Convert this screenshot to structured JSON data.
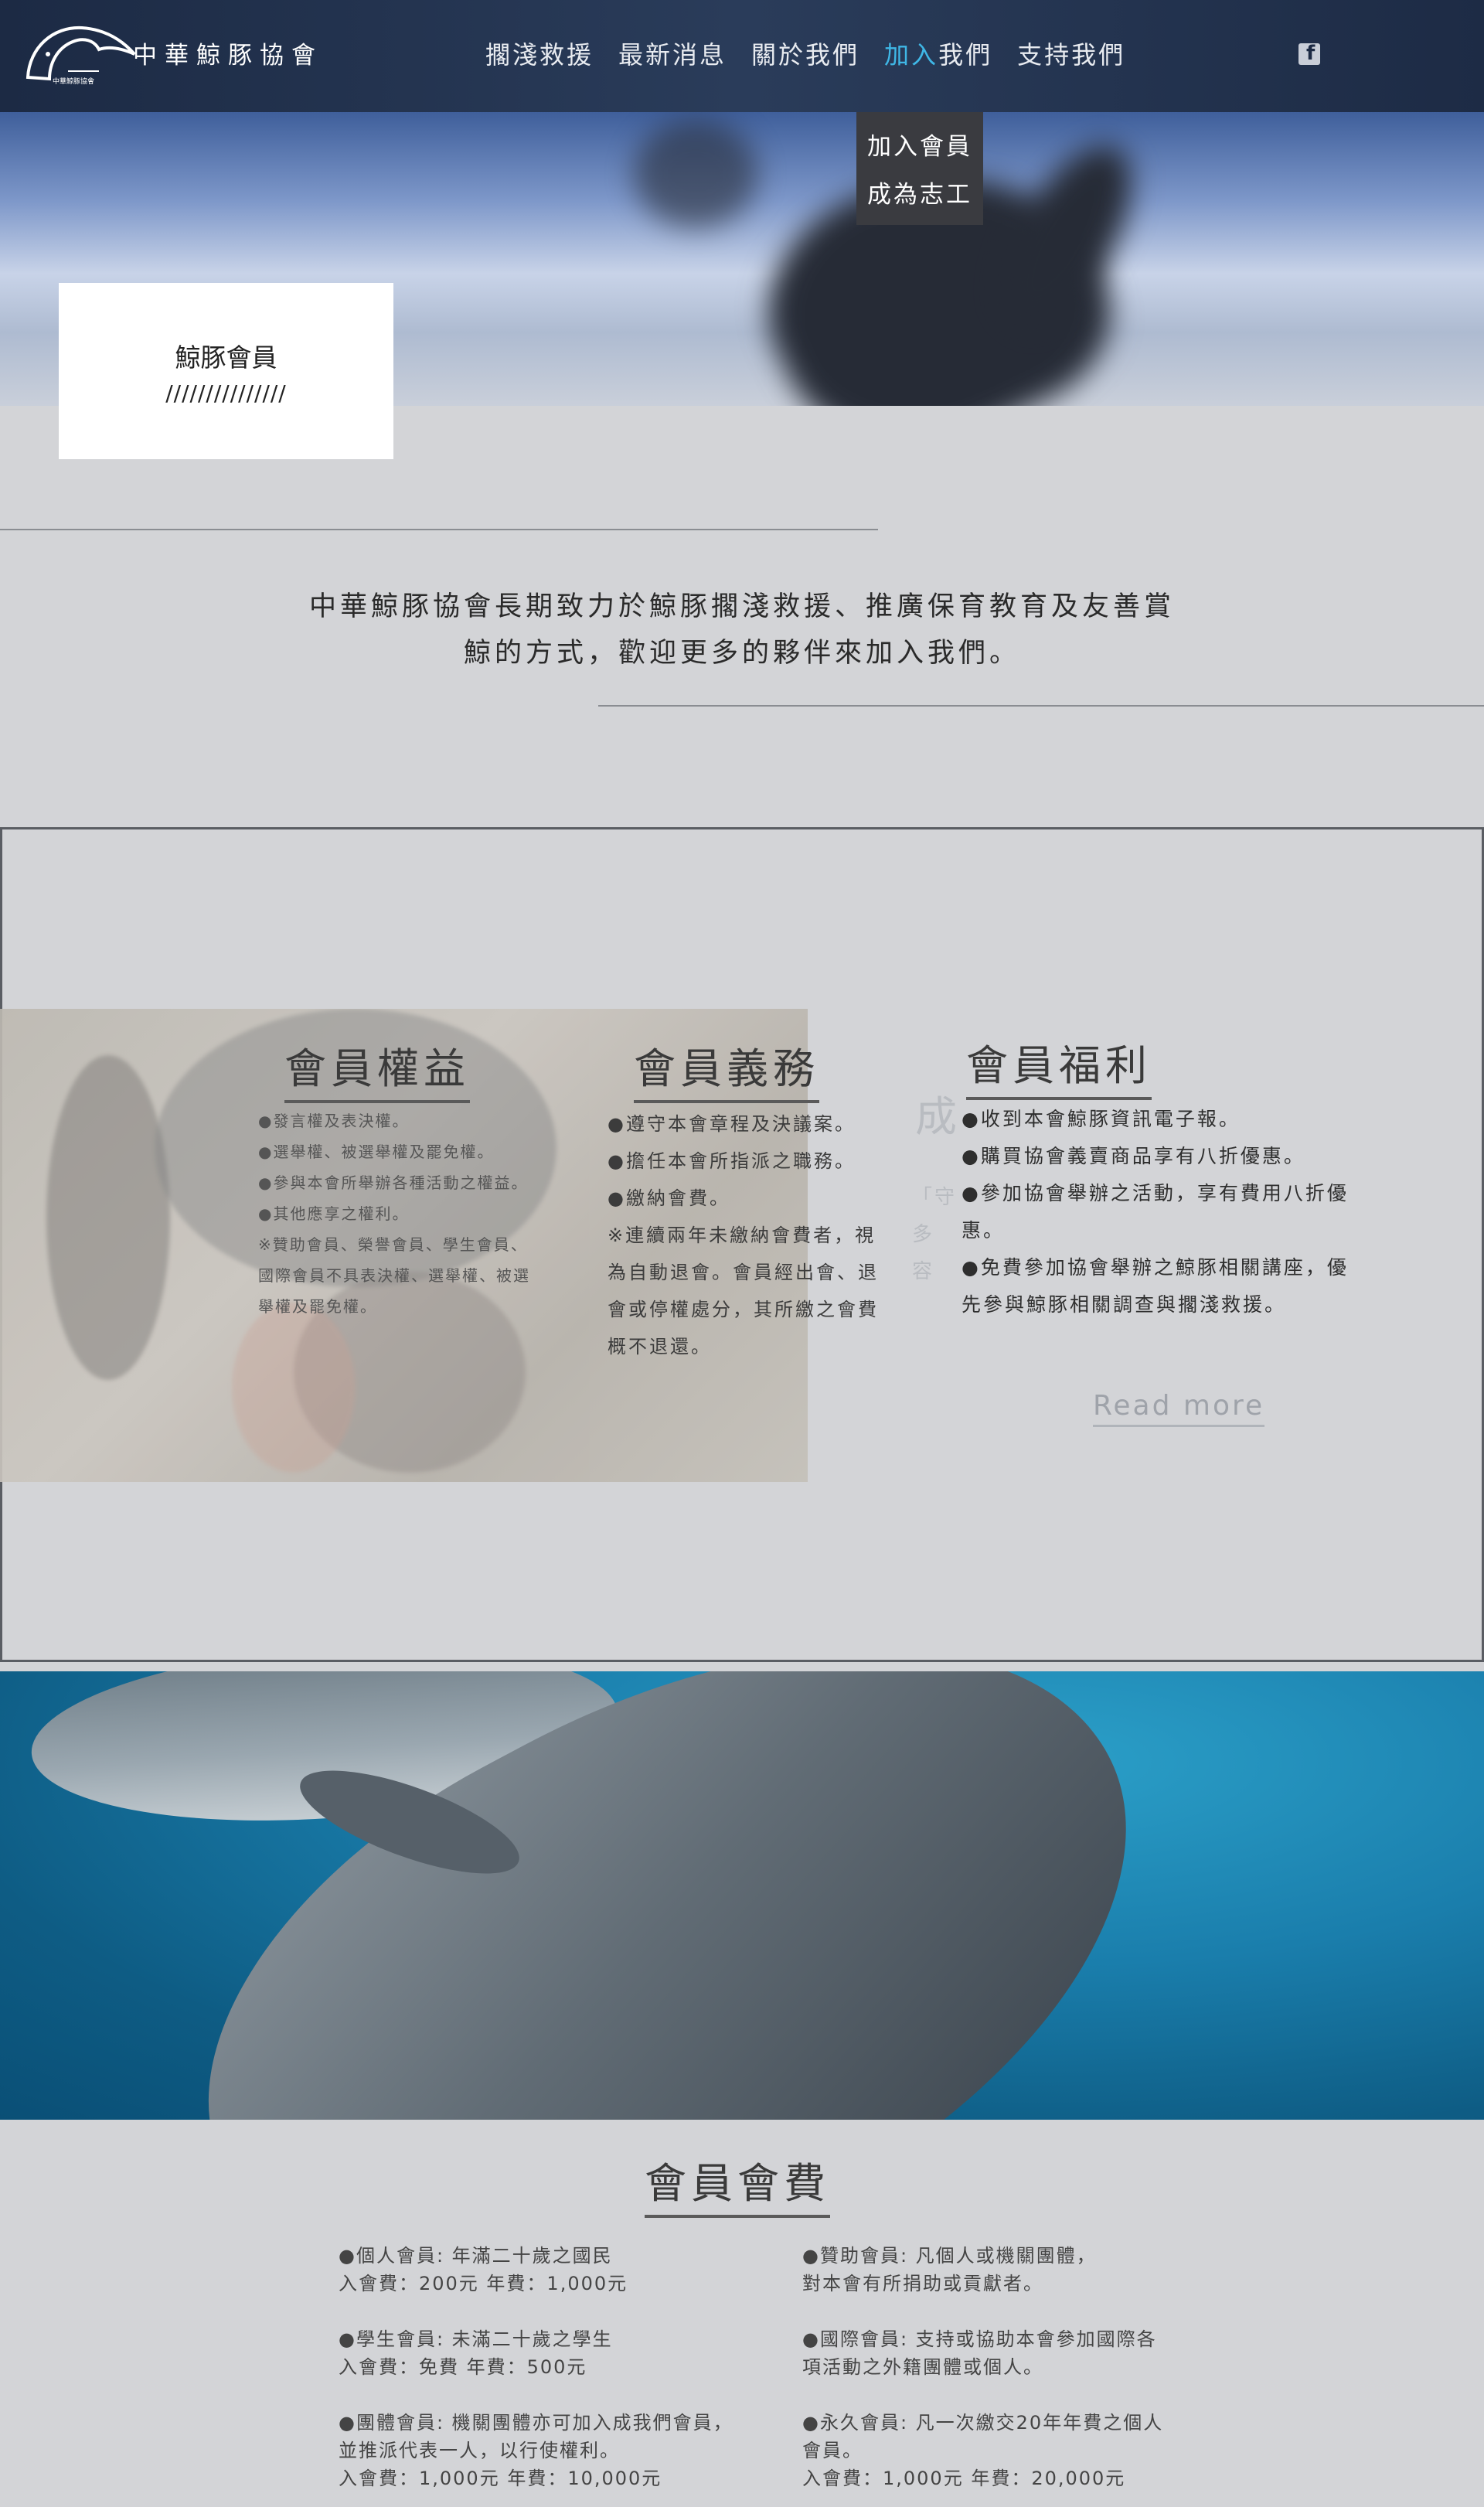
{
  "header": {
    "logo_text": "中華鯨豚協會",
    "nav": [
      {
        "label": "擱淺救援"
      },
      {
        "label": "最新消息"
      },
      {
        "label": "關於我們"
      },
      {
        "label_hl": "加入",
        "label_rest": "我們"
      },
      {
        "label": "支持我們"
      }
    ],
    "dropdown": [
      "加入會員",
      "成為志工"
    ]
  },
  "hero": {
    "card_title": "鯨豚會員",
    "card_sub": "///////////////"
  },
  "intro": {
    "line1": "中華鯨豚協會長期致力於鯨豚擱淺救援、推廣保育教育及友善賞",
    "line2": "鯨的方式，歡迎更多的夥伴來加入我們。"
  },
  "membership": {
    "rights": {
      "title": "會員權益",
      "items": [
        "●發言權及表決權。",
        "●選舉權、被選舉權及罷免權。",
        "●參與本會所舉辦各種活動之權益。",
        "●其他應享之權利。",
        "※贊助會員、榮譽會員、學生會員、",
        "國際會員不具表決權、選舉權、被選",
        "舉權及罷免權。"
      ]
    },
    "duty": {
      "title": "會員義務",
      "items": [
        "●遵守本會章程及決議案。",
        "●擔任本會所指派之職務。",
        "●繳納會費。",
        "※連續兩年未繳納會費者，視",
        "為自動退會。會員經出會、退",
        "會或停權處分，其所繳之會費",
        "概不退還。"
      ]
    },
    "welfare": {
      "title": "會員福利",
      "items": [
        "●收到本會鯨豚資訊電子報。",
        "●購買協會義賣商品享有八折優惠。",
        "●參加協會舉辦之活動，享有費用八折優",
        "惠。",
        "●免費參加協會舉辦之鯨豚相關講座，優",
        "先參與鯨豚相關調查與擱淺救援。"
      ]
    },
    "ghost": {
      "title": "成",
      "lines": [
        "「守",
        "多",
        "容"
      ]
    },
    "read_more": "Read more"
  },
  "fees": {
    "title": "會員會費",
    "left": [
      {
        "line1": "●個人會員: 年滿二十歲之國民",
        "line2": "入會費：200元   年費：1,000元"
      },
      {
        "line1": "●學生會員: 未滿二十歲之學生",
        "line2": "入會費：免費   年費：500元"
      },
      {
        "line1": "●團體會員: 機關團體亦可加入成我們會員，",
        "line2": "並推派代表一人，以行使權利。",
        "line3": "入會費：1,000元   年費：10,000元"
      }
    ],
    "right": [
      {
        "line1": "●贊助會員: 凡個人或機關團體，",
        "line2": "對本會有所捐助或貢獻者。"
      },
      {
        "line1": "●國際會員:  支持或協助本會參加國際各",
        "line2": "項活動之外籍團體或個人。"
      },
      {
        "line1": "●永久會員:  凡一次繳交20年年費之個人",
        "line2": "會員。",
        "line3": "入會費：1,000元   年費：20,000元"
      }
    ]
  },
  "colors": {
    "header_bg": "#1c2a44",
    "accent": "#3fb7e6",
    "page_bg": "#d3d4d7"
  }
}
